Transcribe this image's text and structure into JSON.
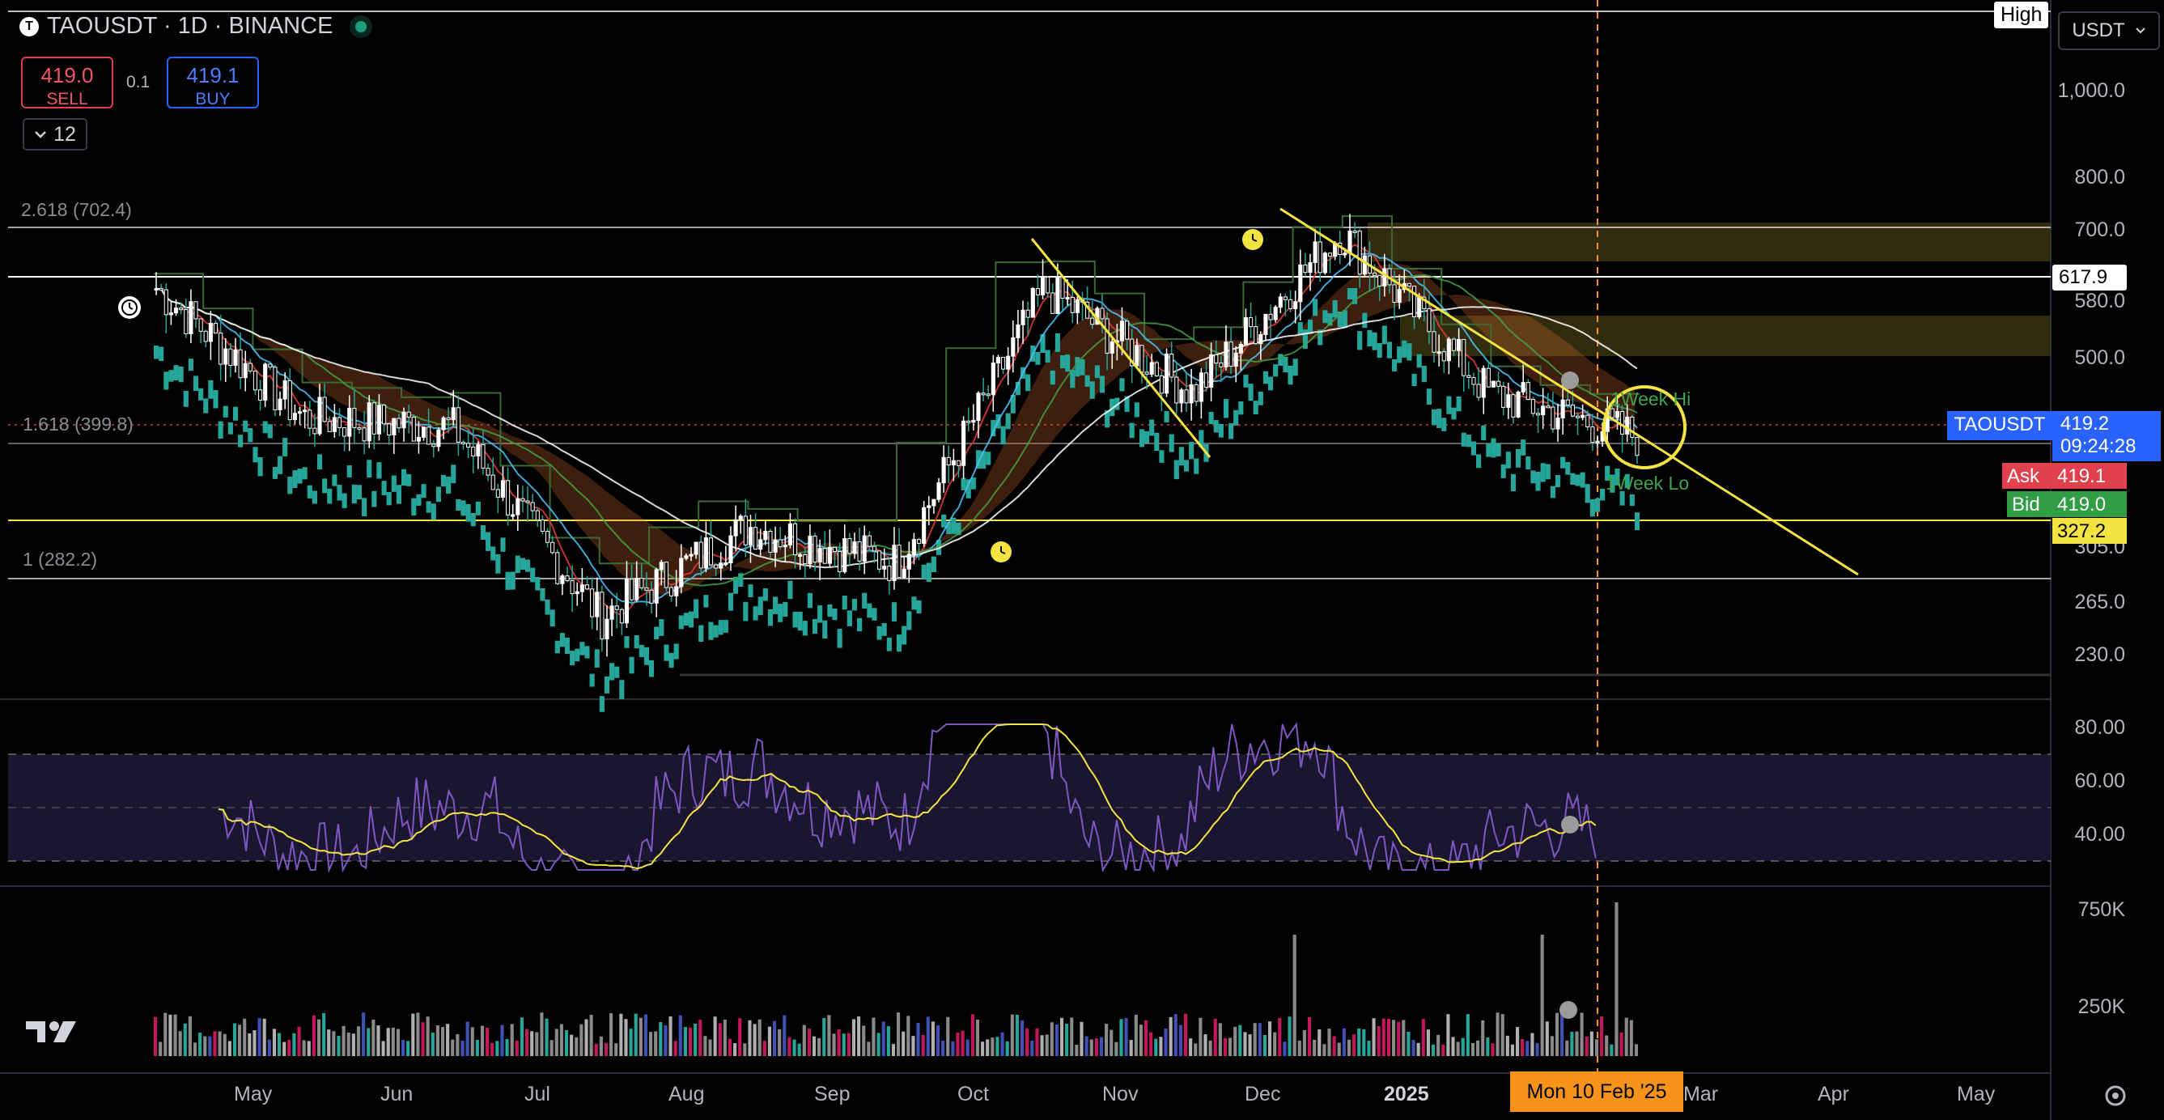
{
  "header": {
    "logo_letter": "T",
    "title": "TAOUSDT · 1D · BINANCE",
    "sell_price": "419.0",
    "sell_label": "SELL",
    "spread": "0.1",
    "buy_price": "419.1",
    "buy_label": "BUY",
    "interval_value": "12"
  },
  "fib_labels": {
    "f2618": "2.618 (702.4)",
    "f1618": "1.618 (399.8)",
    "f1": "1 (282.2)"
  },
  "price_axis": {
    "currency": "USDT",
    "high_label": "High",
    "ticks": [
      "1,000.0",
      "800.0",
      "700.0",
      "580.0",
      "500.0",
      "305.0",
      "265.0",
      "230.0"
    ],
    "level_tag": "617.9",
    "symbol_tag": "TAOUSDT",
    "last_price": "419.2",
    "countdown": "09:24:28",
    "ask_label": "Ask",
    "ask_value": "419.1",
    "bid_label": "Bid",
    "bid_value": "419.0",
    "yellow_level": "327.2"
  },
  "rsi_axis": {
    "ticks": [
      "80.00",
      "60.00",
      "40.00"
    ]
  },
  "volume_axis": {
    "ticks": [
      "750K",
      "250K"
    ]
  },
  "annotations": {
    "week_hi": "1Week Hi",
    "week_lo": "1Week Lo"
  },
  "time_axis": {
    "months": [
      "May",
      "Jun",
      "Jul",
      "Aug",
      "Sep",
      "Oct",
      "Nov",
      "Dec",
      "2025",
      "Mar",
      "Apr",
      "May"
    ],
    "crosshair_date": "Mon 10 Feb '25"
  },
  "colors": {
    "up_candle": "#ffffff",
    "down_candle": "#26a69a",
    "trendline": "#f5e342",
    "rsi": "#7e57c2",
    "rsi_ma": "#f5e342",
    "crosshair": "#f7931a",
    "ribbon": "#e06c2a"
  },
  "chart_data": {
    "type": "candlestick",
    "title": "TAOUSDT · 1D · BINANCE",
    "x": [
      "Apr",
      "May",
      "Jun",
      "Jul",
      "Aug",
      "Sep",
      "Oct",
      "Nov",
      "Dec",
      "Jan 2025",
      "Feb 2025"
    ],
    "series": [
      {
        "name": "TAOUSDT",
        "values": [
          620,
          440,
          430,
          260,
          330,
          300,
          620,
          470,
          720,
          470,
          419.2
        ]
      }
    ],
    "ylim": [
      210,
      1300
    ],
    "y_scale": "log",
    "horizontal_levels": [
      702.4,
      617.9,
      399.8,
      327.2,
      282.2
    ],
    "rsi": {
      "ylim": [
        20,
        90
      ],
      "bands": [
        30,
        50,
        70
      ]
    }
  }
}
